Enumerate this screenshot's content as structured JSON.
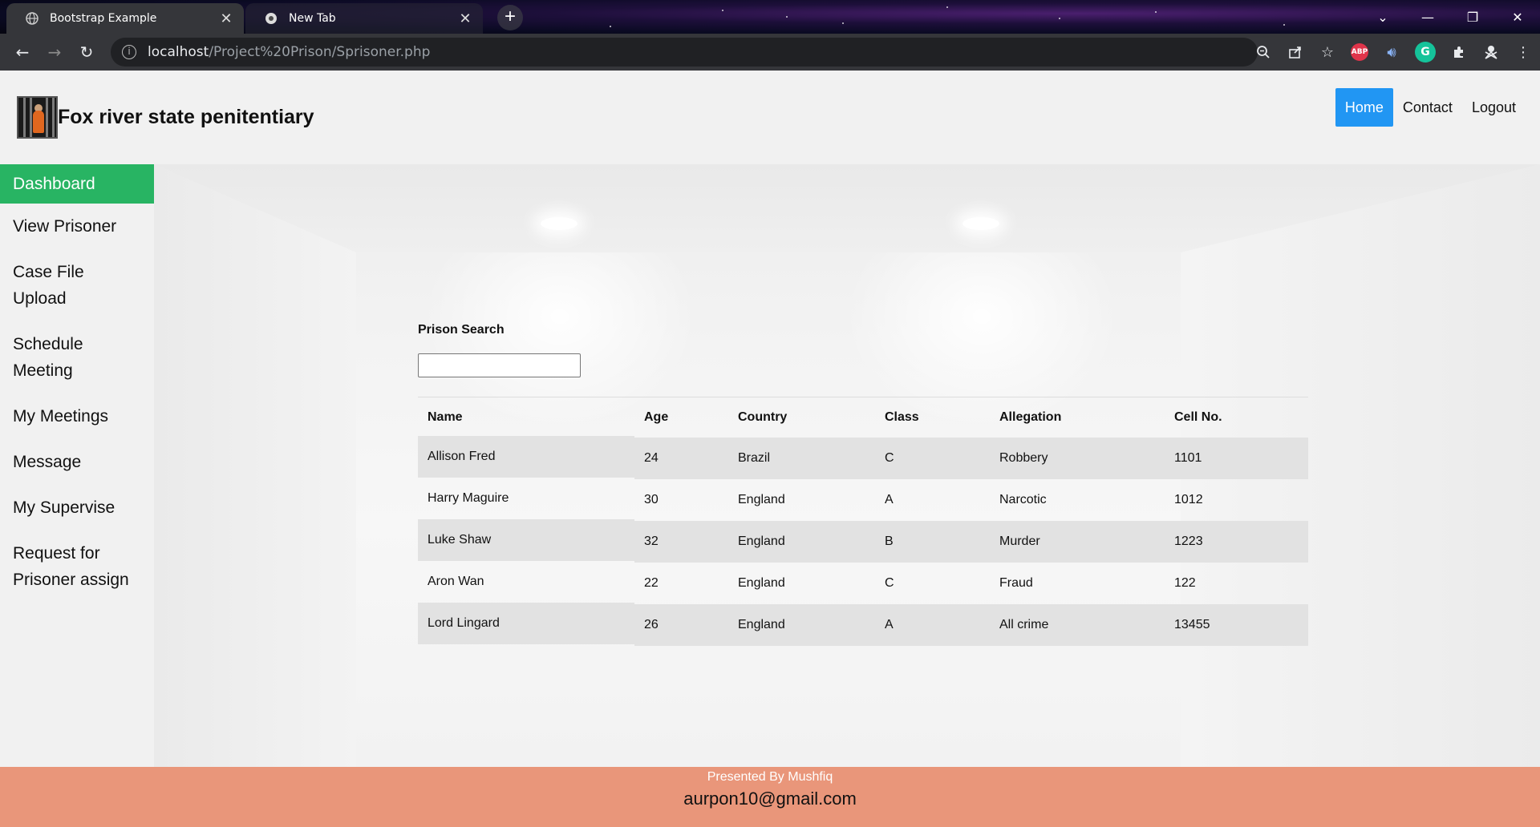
{
  "browser": {
    "tabs": [
      {
        "title": "Bootstrap Example",
        "active": true
      },
      {
        "title": "New Tab",
        "active": false
      }
    ],
    "new_tab_label": "+",
    "url_host": "localhost",
    "url_path": "/Project%20Prison/Sprisoner.php",
    "window_controls": {
      "dropdown": "⌄",
      "minimize": "—",
      "restore": "❐",
      "close": "✕"
    },
    "extension_labels": {
      "abp": "ABP",
      "grammarly": "G"
    }
  },
  "header": {
    "title": "Fox river state penitentiary",
    "nav": [
      {
        "label": "Home",
        "active": true
      },
      {
        "label": "Contact",
        "active": false
      },
      {
        "label": "Logout",
        "active": false
      }
    ]
  },
  "sidebar": {
    "items": [
      {
        "label": "Dashboard",
        "active": true
      },
      {
        "label": "View Prisoner"
      },
      {
        "label": "Case File Upload"
      },
      {
        "label": "Schedule Meeting"
      },
      {
        "label": "My Meetings"
      },
      {
        "label": "Message"
      },
      {
        "label": "My Supervise"
      },
      {
        "label": "Request for Prisoner assign"
      }
    ]
  },
  "search": {
    "label": "Prison Search",
    "value": "",
    "placeholder": ""
  },
  "table": {
    "columns": [
      "Name",
      "Age",
      "Country",
      "Class",
      "Allegation",
      "Cell No."
    ],
    "rows": [
      [
        "Allison Fred",
        "24",
        "Brazil",
        "C",
        "Robbery",
        "1101"
      ],
      [
        "Harry Maguire",
        "30",
        "England",
        "A",
        "Narcotic",
        "1012"
      ],
      [
        "Luke Shaw",
        "32",
        "England",
        "B",
        "Murder",
        "1223"
      ],
      [
        "Aron Wan",
        "22",
        "England",
        "C",
        "Fraud",
        "122"
      ],
      [
        "Lord Lingard",
        "26",
        "England",
        "A",
        "All crime",
        "13455"
      ]
    ]
  },
  "footer": {
    "presented": "Presented By Mushfiq",
    "email": "aurpon10@gmail.com"
  },
  "colors": {
    "sidebar_active": "#28b463",
    "nav_active": "#2196f3",
    "footer_bg": "#e9967a"
  }
}
